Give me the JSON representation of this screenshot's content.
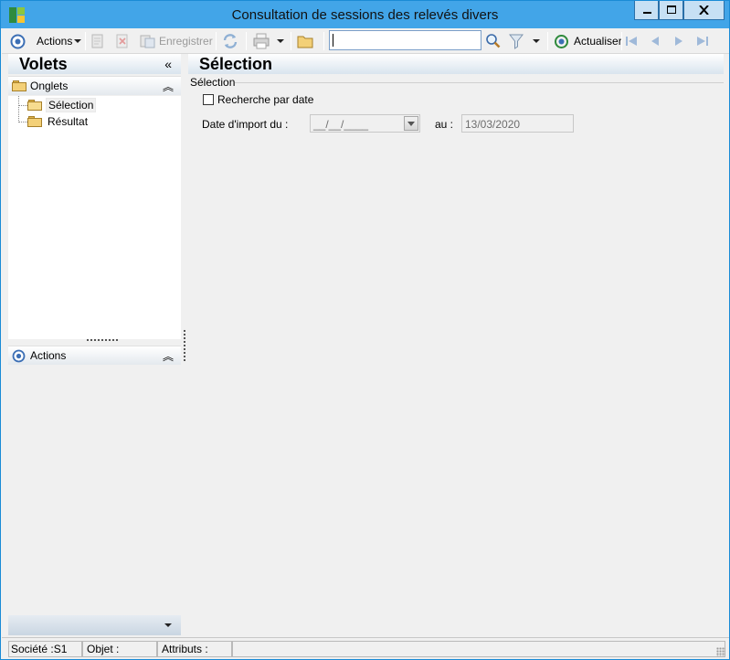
{
  "window": {
    "title": "Consultation de sessions des relevés divers"
  },
  "toolbar": {
    "actions_label": "Actions",
    "save_label": "Enregistrer",
    "search_value": "",
    "refresh_label": "Actualiser"
  },
  "left_panel": {
    "title": "Volets",
    "tabs_section": {
      "label": "Onglets",
      "items": [
        {
          "label": "Sélection",
          "selected": true
        },
        {
          "label": "Résultat",
          "selected": false
        }
      ]
    },
    "actions_section": {
      "label": "Actions"
    }
  },
  "main": {
    "title": "Sélection",
    "group_label": "Sélection",
    "checkbox_label": "Recherche par date",
    "checkbox_checked": false,
    "date_from_label": "Date d'import du :",
    "date_from_value": "__/__/____",
    "date_to_label": "au :",
    "date_to_value": "13/03/2020"
  },
  "statusbar": {
    "societe": "Société :S1",
    "objet": "Objet :",
    "attributs": "Attributs :"
  },
  "colors": {
    "titlebar": "#42a5e8",
    "window_border": "#1a8bd6",
    "header_gradient_end": "#d9e4ee"
  }
}
